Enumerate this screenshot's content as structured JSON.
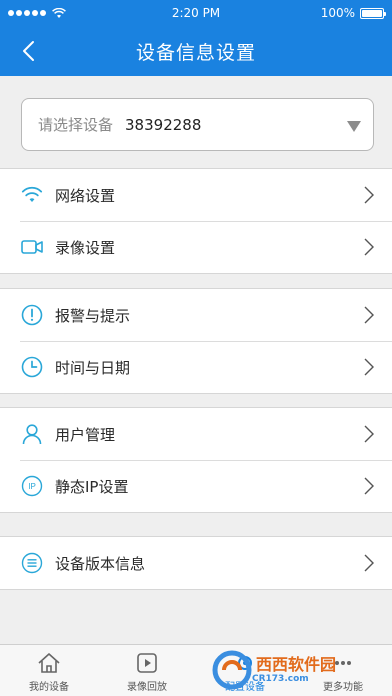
{
  "status_bar": {
    "time": "2:20 PM",
    "battery": "100%",
    "battery_level": 1.0
  },
  "nav": {
    "title": "设备信息设置",
    "back_icon": "chevron-left-icon"
  },
  "device_selector": {
    "label": "请选择设备",
    "value": "38392288"
  },
  "groups": [
    {
      "items": [
        {
          "label": "网络设置",
          "icon": "wifi-icon"
        },
        {
          "label": "录像设置",
          "icon": "video-camera-icon"
        }
      ]
    },
    {
      "items": [
        {
          "label": "报警与提示",
          "icon": "alert-icon"
        },
        {
          "label": "时间与日期",
          "icon": "clock-icon"
        }
      ]
    },
    {
      "items": [
        {
          "label": "用户管理",
          "icon": "user-icon"
        },
        {
          "label": "静态IP设置",
          "icon": "ip-icon"
        }
      ]
    },
    {
      "items": [
        {
          "label": "设备版本信息",
          "icon": "list-icon"
        }
      ]
    }
  ],
  "tabs": [
    {
      "label": "我的设备",
      "icon": "home-icon",
      "active": false
    },
    {
      "label": "录像回放",
      "icon": "play-icon",
      "active": false
    },
    {
      "label": "配置设备",
      "icon": "settings-icon",
      "active": true
    },
    {
      "label": "更多功能",
      "icon": "more-icon",
      "active": false
    }
  ],
  "watermark": {
    "text": "西西软件园",
    "sub": "CR173.com"
  },
  "colors": {
    "primary": "#1a82e0",
    "icon_accent": "#2aa7d8",
    "background": "#efefef"
  }
}
